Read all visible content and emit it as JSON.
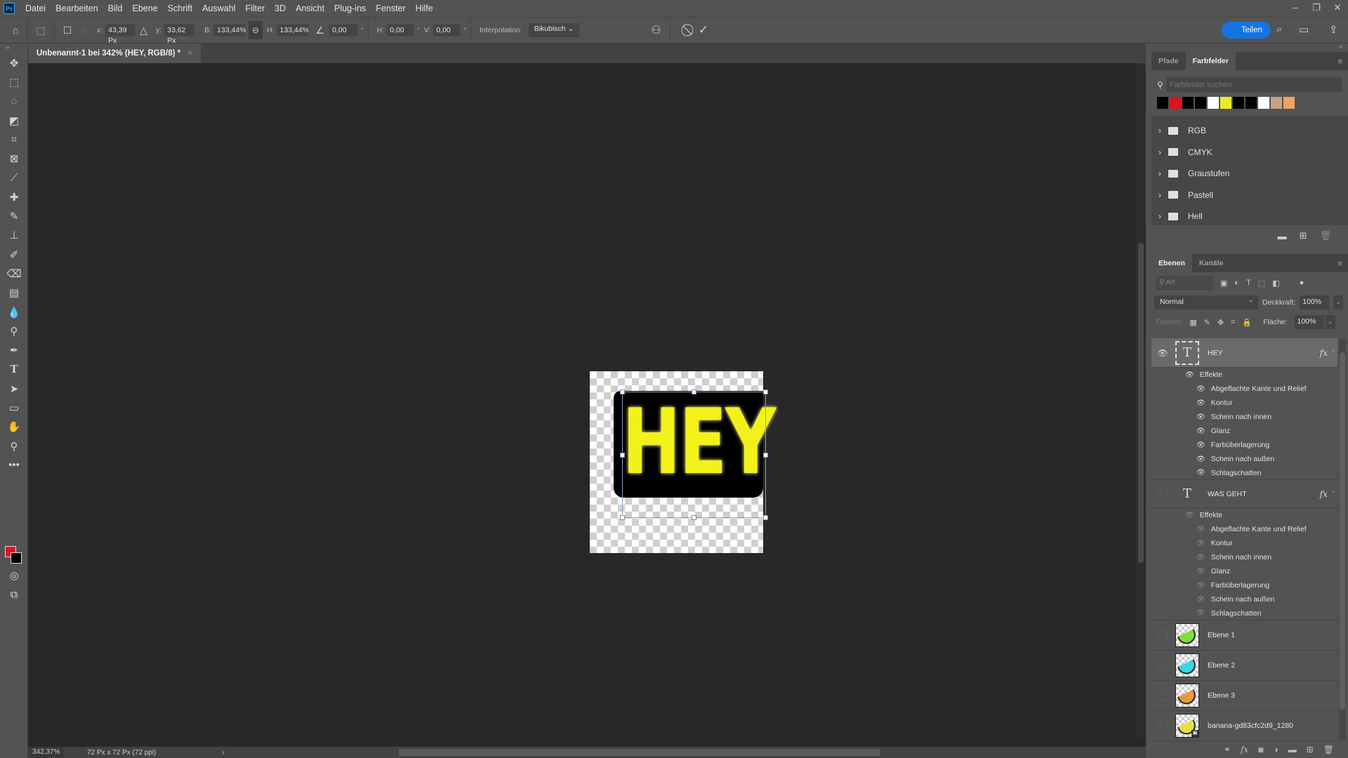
{
  "app": {
    "logo": "Ps"
  },
  "menu": [
    "Datei",
    "Bearbeiten",
    "Bild",
    "Ebene",
    "Schrift",
    "Auswahl",
    "Filter",
    "3D",
    "Ansicht",
    "Plug-ins",
    "Fenster",
    "Hilfe"
  ],
  "window_controls": {
    "minimize": "–",
    "restore": "❐",
    "close": "✕"
  },
  "options": {
    "x_label": "x:",
    "x_value": "43,39 Px",
    "y_label": "y:",
    "y_value": "33,62 Px",
    "w_label": "B:",
    "w_value": "133,44%",
    "h_label": "H:",
    "h_value": "133,44%",
    "angle_value": "0,00",
    "deg": "°",
    "hskew_label": "H:",
    "hskew_value": "0,00",
    "vskew_label": "V:",
    "vskew_value": "0,00",
    "interp_label": "Interpolation:",
    "interp_value": "Bikubisch"
  },
  "share_button": "Teilen",
  "document_tab": {
    "title": "Unbenannt-1 bei 342% (HEY, RGB/8) *",
    "close": "×"
  },
  "canvas": {
    "text": "HEY",
    "text_color": "#f2f21a"
  },
  "status": {
    "zoom": "342,37%",
    "doc_info": "72 Px x 72 Px (72 ppi)",
    "arrow": "›"
  },
  "swatches_panel": {
    "tabs": [
      "Pfade",
      "Farbfelder"
    ],
    "active_tab": "Farbfelder",
    "search_placeholder": "Farbfelder suchen",
    "colors": [
      "#000000",
      "#e0101e",
      "#000000",
      "#000000",
      "#ffffff",
      "#eaea2a",
      "#000000",
      "#000000",
      "#ffffff",
      "#c9a080",
      "#eaa560"
    ],
    "groups": [
      "RGB",
      "CMYK",
      "Graustufen",
      "Pastell",
      "Hell"
    ]
  },
  "layers_panel": {
    "tabs": [
      "Ebenen",
      "Kanäle"
    ],
    "active_tab": "Ebenen",
    "filter_placeholder": "Art",
    "blend_mode": "Normal",
    "opacity_label": "Deckkraft:",
    "opacity": "100%",
    "lock_label": "Fixieren:",
    "fill_label": "Fläche:",
    "fill": "100%",
    "effects_label": "Effekte",
    "effect_names": [
      "Abgeflachte Kante und Relief",
      "Kontur",
      "Schein nach innen",
      "Glanz",
      "Farbüberlagerung",
      "Schein nach außen",
      "Schlagschatten"
    ],
    "layers": [
      {
        "name": "HEY",
        "type": "text",
        "visible": true,
        "selected": true
      },
      {
        "name": "WAS GEHT",
        "type": "text",
        "visible": false
      },
      {
        "name": "Ebene 1",
        "type": "image",
        "color": "#7ee03a"
      },
      {
        "name": "Ebene 2",
        "type": "image",
        "color": "#39d4e8"
      },
      {
        "name": "Ebene 3",
        "type": "image",
        "color": "#e89a3a"
      },
      {
        "name": "banana-gd83cfc2d9_1280",
        "type": "smart",
        "color": "#e6e040"
      }
    ]
  }
}
